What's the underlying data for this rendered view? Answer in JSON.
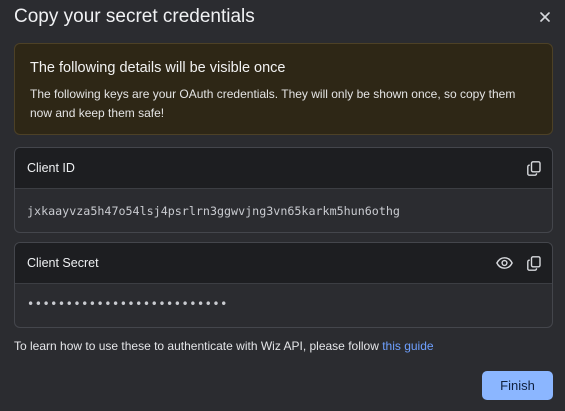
{
  "dialog": {
    "title": "Copy your secret credentials",
    "close_icon": "close-icon"
  },
  "alert": {
    "title": "The following details will be visible once",
    "body": "The following keys are your OAuth credentials. They will only be shown once, so copy them now and keep them safe!"
  },
  "client_id": {
    "label": "Client ID",
    "value": "jxkaayvza5h47o54lsj4psrlrn3ggwvjng3vn65karkm5hun6othg",
    "copy_icon": "copy-icon"
  },
  "client_secret": {
    "label": "Client Secret",
    "masked_value": "••••••••••••••••••••••••••",
    "reveal_icon": "eye-icon",
    "copy_icon": "copy-icon"
  },
  "footer": {
    "text": "To learn how to use these to authenticate with Wiz API, please follow ",
    "link": "this guide"
  },
  "actions": {
    "finish_label": "Finish"
  },
  "colors": {
    "background": "#2b2c30",
    "alert_background": "#2e2716",
    "alert_border": "#4d4126",
    "primary_button": "#8bb6ff",
    "link": "#6ea0ff"
  }
}
